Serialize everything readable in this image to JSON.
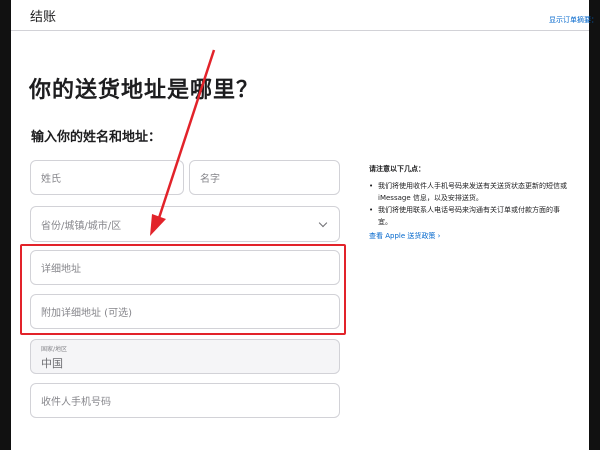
{
  "header": {
    "title": "结账",
    "summary_link": "显示订单摘要："
  },
  "page_title": "你的送货地址是哪里？",
  "section_title": "输入你的姓名和地址：",
  "form": {
    "surname_placeholder": "姓氏",
    "given_name_placeholder": "名字",
    "region_placeholder": "省份/城镇/城市/区",
    "address_placeholder": "详细地址",
    "address2_placeholder": "附加详细地址 (可选)",
    "country_label": "国家/地区",
    "country_value": "中国",
    "phone_placeholder": "收件人手机号码"
  },
  "notes": {
    "title": "请注意以下几点：",
    "items": [
      "我们将使用收件人手机号码来发送有关送货状态更新的短信或 iMessage 信息，以及安排送货。",
      "我们将使用联系人电话号码来沟通有关订单或付款方面的事宜。"
    ],
    "bullet": "•",
    "link": "查看 Apple 送货政策 ›"
  },
  "colors": {
    "accent_link": "#0066cc",
    "annotation_red": "#e2232a",
    "border": "#d2d2d7"
  }
}
